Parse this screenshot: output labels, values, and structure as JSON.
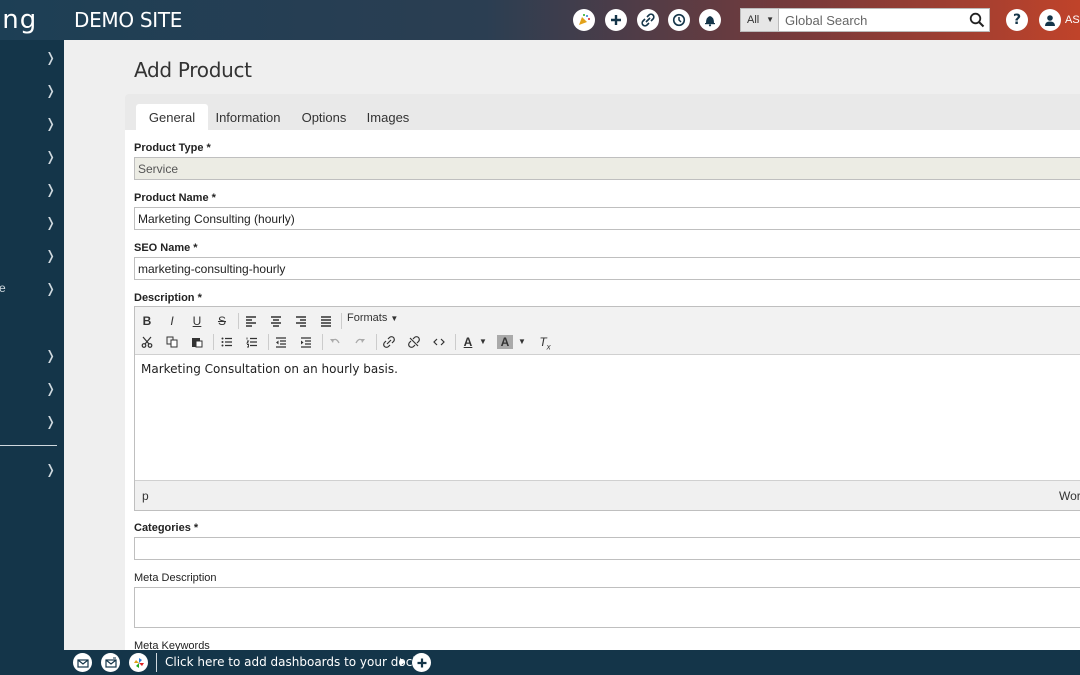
{
  "app": {
    "logo_fragment": "ing",
    "site_title": "DEMO SITE",
    "user_name_fragment": "AS"
  },
  "topbar": {
    "icons": [
      "party-icon",
      "plus-icon",
      "link-icon",
      "history-icon",
      "bell-icon"
    ],
    "search": {
      "scope": "All",
      "placeholder": "Global Search"
    },
    "help_icon": "question-icon",
    "user_icon": "user-icon"
  },
  "sidebar": {
    "items": [
      {
        "label": ""
      },
      {
        "label": ""
      },
      {
        "label": ""
      },
      {
        "label": ""
      },
      {
        "label": ""
      },
      {
        "label": ""
      },
      {
        "label": ""
      },
      {
        "label": "e"
      },
      {
        "label": ""
      },
      {
        "label": ""
      },
      {
        "label": ""
      },
      {
        "label": ""
      }
    ]
  },
  "page": {
    "title": "Add Product"
  },
  "tabs": [
    {
      "label": "General",
      "active": true
    },
    {
      "label": "Information",
      "active": false
    },
    {
      "label": "Options",
      "active": false
    },
    {
      "label": "Images",
      "active": false
    }
  ],
  "form": {
    "product_type": {
      "label": "Product Type *",
      "value": "Service"
    },
    "product_name": {
      "label": "Product Name *",
      "value": "Marketing Consulting (hourly)"
    },
    "seo_name": {
      "label": "SEO Name *",
      "value": "marketing-consulting-hourly"
    },
    "description": {
      "label": "Description *",
      "formats_label": "Formats",
      "content": "Marketing Consultation on an hourly basis.",
      "path": "p",
      "word_count_fragment": "Wor"
    },
    "categories": {
      "label": "Categories *",
      "value": ""
    },
    "meta_description": {
      "label": "Meta Description",
      "value": ""
    },
    "meta_keywords": {
      "label": "Meta Keywords"
    }
  },
  "editor_toolbar": {
    "bold": "B",
    "italic": "I",
    "underline": "U",
    "strike": "S",
    "text_color": "A",
    "bg_color": "A",
    "clear_format": "T"
  },
  "dock": {
    "text": "Click here to add dashboards to your dock"
  },
  "colors": {
    "sidebar_bg": "#143549",
    "topbar_left": "#1d3f55",
    "topbar_right": "#c0432a"
  }
}
